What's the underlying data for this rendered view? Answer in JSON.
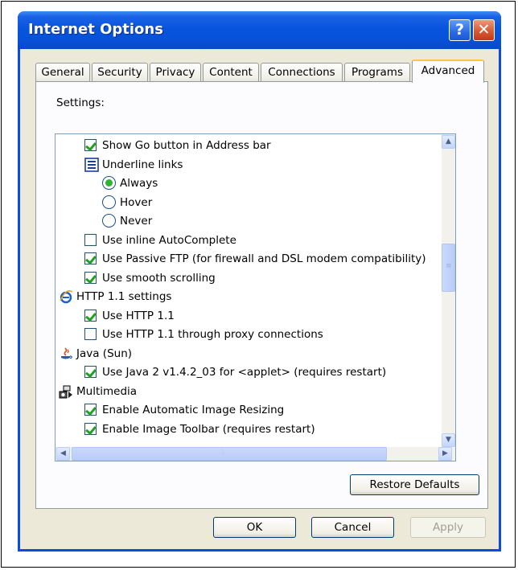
{
  "window": {
    "title": "Internet Options",
    "help_label": "?",
    "close_label": "✕"
  },
  "tabs": [
    "General",
    "Security",
    "Privacy",
    "Content",
    "Connections",
    "Programs",
    "Advanced"
  ],
  "settings_label": "Settings:",
  "rows": [
    {
      "kind": "checkbox",
      "checked": true,
      "label": "Show Go button in Address bar"
    },
    {
      "kind": "group",
      "icon": "list-icon",
      "label": "Underline links"
    },
    {
      "kind": "radio",
      "selected": true,
      "label": "Always"
    },
    {
      "kind": "radio",
      "selected": false,
      "label": "Hover"
    },
    {
      "kind": "radio",
      "selected": false,
      "label": "Never"
    },
    {
      "kind": "checkbox",
      "checked": false,
      "label": "Use inline AutoComplete"
    },
    {
      "kind": "checkbox",
      "checked": true,
      "label": "Use Passive FTP (for firewall and DSL modem compatibility)"
    },
    {
      "kind": "checkbox",
      "checked": true,
      "label": "Use smooth scrolling"
    },
    {
      "kind": "group",
      "icon": "ie-icon",
      "label": "HTTP 1.1 settings"
    },
    {
      "kind": "checkbox",
      "checked": true,
      "label": "Use HTTP 1.1"
    },
    {
      "kind": "checkbox",
      "checked": false,
      "label": "Use HTTP 1.1 through proxy connections"
    },
    {
      "kind": "group",
      "icon": "java-icon",
      "label": "Java (Sun)"
    },
    {
      "kind": "checkbox",
      "checked": true,
      "label": "Use Java 2 v1.4.2_03 for <applet> (requires restart)"
    },
    {
      "kind": "group",
      "icon": "multimedia-icon",
      "label": "Multimedia"
    },
    {
      "kind": "checkbox",
      "checked": true,
      "label": "Enable Automatic Image Resizing"
    },
    {
      "kind": "checkbox",
      "checked": true,
      "label": "Enable Image Toolbar (requires restart)"
    }
  ],
  "buttons": {
    "restore": "Restore Defaults",
    "ok": "OK",
    "cancel": "Cancel",
    "apply": "Apply"
  }
}
